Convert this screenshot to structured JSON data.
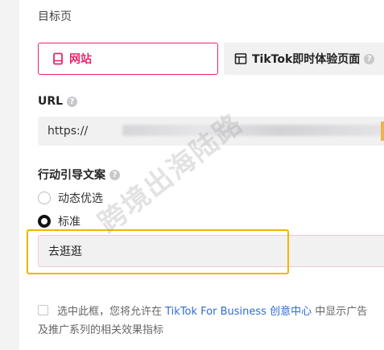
{
  "destination": {
    "title": "目标页",
    "website_label": "网站",
    "tiktok_label": "TikTok即时体验页面"
  },
  "url": {
    "label": "URL",
    "prefix": "https://"
  },
  "cta": {
    "label": "行动引导文案",
    "options": [
      {
        "label": "动态优选",
        "selected": false
      },
      {
        "label": "标准",
        "selected": true
      }
    ],
    "value": "去逛逛"
  },
  "consent": {
    "text_before": "选中此框，您将允许在 ",
    "link": "TikTok For Business 创意中心",
    "text_after": " 中显示广告",
    "line2": "及推广系列的相关效果指标"
  },
  "watermark": "跨境出海陆路",
  "colors": {
    "accent": "#e8266e",
    "highlight": "#f4b400",
    "link": "#2f6bd8"
  }
}
